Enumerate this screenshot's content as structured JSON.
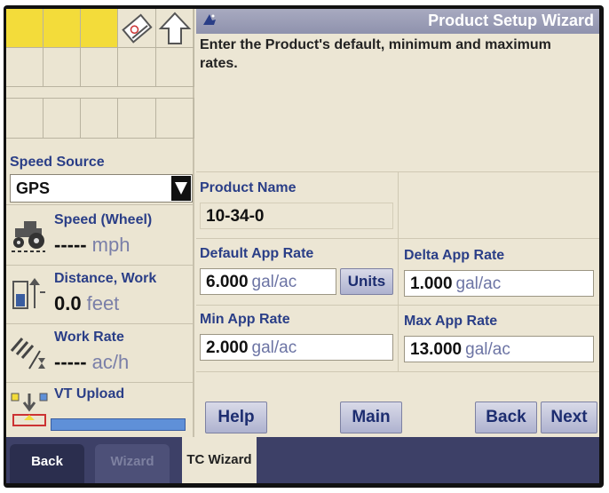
{
  "window": {
    "title": "Product Setup Wizard"
  },
  "instructions": "Enter the Product's default, minimum and maximum rates.",
  "left_panel": {
    "speed_source": {
      "label": "Speed Source",
      "value": "GPS"
    },
    "speed": {
      "label": "Speed (Wheel)",
      "value": "-----",
      "unit": "mph"
    },
    "distance": {
      "label": "Distance, Work",
      "value": "0.0",
      "unit": "feet"
    },
    "work_rate": {
      "label": "Work Rate",
      "value": "-----",
      "unit": "ac/h"
    },
    "vt_upload": {
      "label": "VT Upload"
    }
  },
  "form": {
    "product_name": {
      "label": "Product Name",
      "value": "10-34-0"
    },
    "default_app_rate": {
      "label": "Default App Rate",
      "value": "6.000",
      "unit": "gal/ac"
    },
    "delta_app_rate": {
      "label": "Delta App Rate",
      "value": "1.000",
      "unit": "gal/ac"
    },
    "min_app_rate": {
      "label": "Min App Rate",
      "value": "2.000",
      "unit": "gal/ac"
    },
    "max_app_rate": {
      "label": "Max App Rate",
      "value": "13.000",
      "unit": "gal/ac"
    },
    "units_label": "Units"
  },
  "buttons": {
    "help": "Help",
    "main": "Main",
    "back": "Back",
    "next": "Next"
  },
  "tabs": {
    "back": "Back",
    "wizard": "Wizard",
    "tc_wizard": "TC Wizard"
  },
  "colors": {
    "accent_blue": "#2a3e87",
    "highlight_yellow": "#f3dc3a",
    "tab_bar": "#3d4067"
  },
  "icons": [
    "wizard-book-icon",
    "up-arrow-icon",
    "tractor-icon",
    "distance-icon",
    "work-rate-icon",
    "vt-upload-icon",
    "wizard-hat-icon"
  ]
}
